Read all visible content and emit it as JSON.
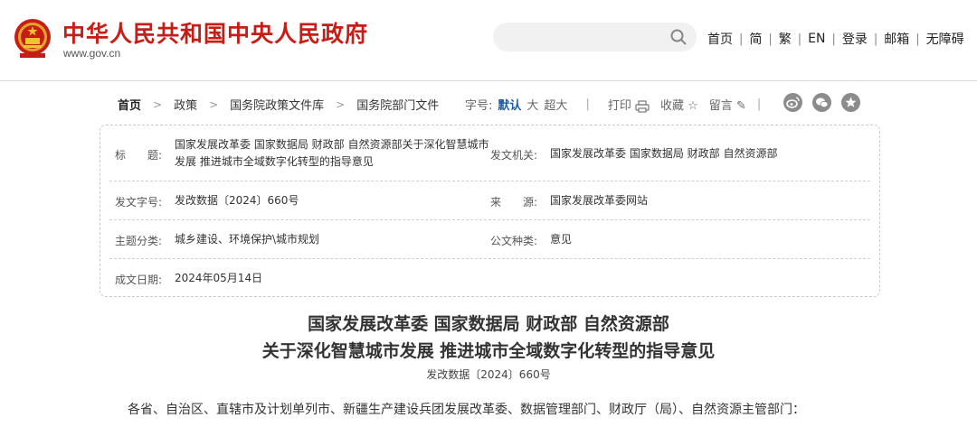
{
  "header": {
    "site_title": "中华人民共和国中央人民政府",
    "site_url": "www.gov.cn",
    "search_placeholder": "",
    "nav": [
      "首页",
      "简",
      "繁",
      "EN",
      "登录",
      "邮箱",
      "无障碍"
    ]
  },
  "breadcrumb": {
    "items": [
      "首页",
      "政策",
      "国务院政策文件库",
      "国务院部门文件"
    ]
  },
  "toolbar": {
    "font_size_label": "字号:",
    "font_default": "默认",
    "font_large": "大",
    "font_xlarge": "超大",
    "print_label": "打印",
    "favorite_label": "收藏",
    "comment_label": "留言"
  },
  "info": {
    "title_label": "标　　题:",
    "title_value": "国家发展改革委 国家数据局 财政部 自然资源部关于深化智慧城市发展 推进城市全域数字化转型的指导意见",
    "issuer_label": "发文机关:",
    "issuer_value": "国家发展改革委 国家数据局 财政部 自然资源部",
    "docno_label": "发文字号:",
    "docno_value": "发改数据〔2024〕660号",
    "source_label": "来　　源:",
    "source_value": "国家发展改革委网站",
    "category_label": "主题分类:",
    "category_value": "城乡建设、环境保护\\城市规划",
    "type_label": "公文种类:",
    "type_value": "意见",
    "date_label": "成文日期:",
    "date_value": "2024年05月14日"
  },
  "article": {
    "title_line1": "国家发展改革委 国家数据局 财政部 自然资源部",
    "title_line2": "关于深化智慧城市发展 推进城市全域数字化转型的指导意见",
    "doc_number": "发改数据〔2024〕660号",
    "first_paragraph": "各省、自治区、直辖市及计划单列市、新疆生产建设兵团发展改革委、数据管理部门、财政厅（局）、自然资源主管部门："
  },
  "colors": {
    "brand_red": "#c81d17",
    "active_blue": "#1c5ca3"
  }
}
